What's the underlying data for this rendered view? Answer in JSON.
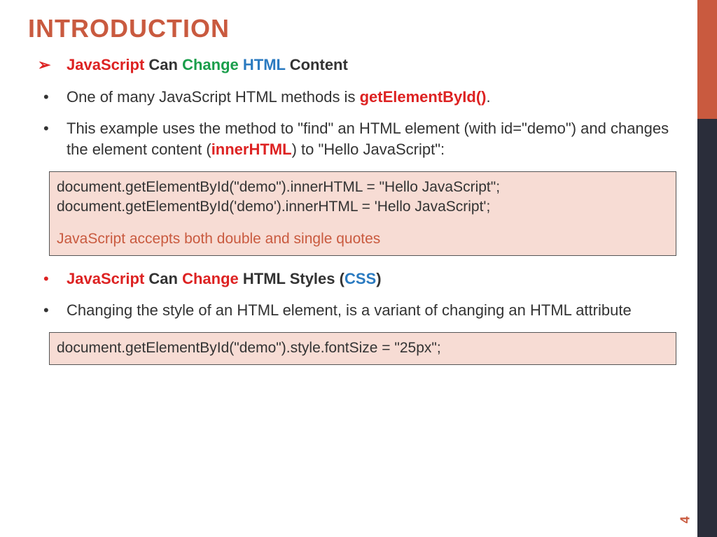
{
  "title": "INTRODUCTION",
  "bullets": {
    "b1": {
      "javascript": "JavaScript",
      "can": " Can ",
      "change": "Change",
      "sp": " ",
      "html": "HTML",
      "content": " Content"
    },
    "b2": {
      "pre": "One of many JavaScript HTML methods is ",
      "method": "getElementById()",
      "post": "."
    },
    "b3": {
      "pre": "This example uses the method to \"find\" an HTML element (with id=\"demo\") and changes the element content (",
      "inner": "innerHTML",
      "post": ") to \"Hello JavaScript\":"
    },
    "code1": {
      "line1": "document.getElementById(\"demo\").innerHTML = \"Hello JavaScript\";",
      "line2": "document.getElementById('demo').innerHTML = 'Hello JavaScript';",
      "note": "JavaScript accepts both double and single quotes"
    },
    "b4": {
      "javascript": "JavaScript",
      "can": " Can ",
      "change": "Change",
      "mid": " HTML Styles (",
      "css": "CSS",
      "post": ")"
    },
    "b5": "Changing the style of an HTML element, is a variant of changing an HTML attribute",
    "code2": "document.getElementById(\"demo\").style.fontSize = \"25px\";"
  },
  "page_number": "4"
}
